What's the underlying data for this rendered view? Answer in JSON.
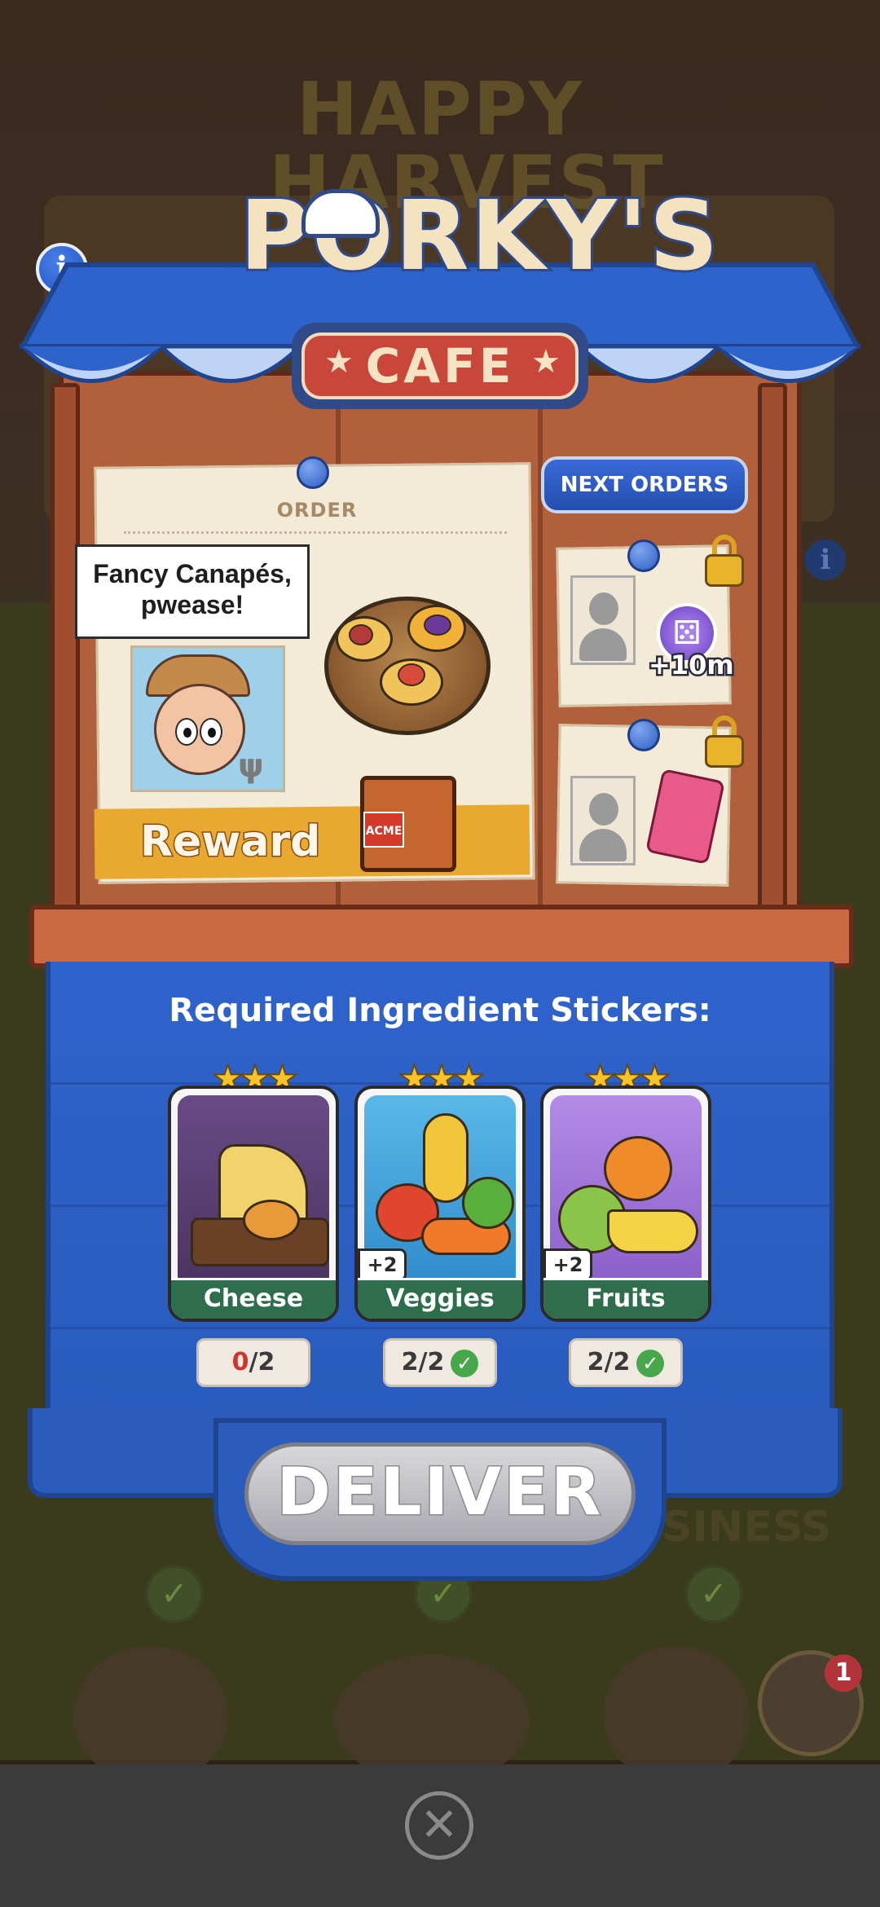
{
  "background": {
    "event_title_line1": "HAPPY",
    "event_title_line2": "HARVEST",
    "ghost_word_right": "SINESS"
  },
  "header": {
    "info_label": "i",
    "sign_title": "PORKY'S",
    "sign_subtitle": "CAFE"
  },
  "order": {
    "label": "ORDER",
    "speech": "Fancy Canapés, pwease!",
    "reward_label": "Reward",
    "reward_crate_text": "ACME"
  },
  "next_orders": {
    "button_label": "NEXT ORDERS",
    "items": [
      {
        "reward_text": "+10m",
        "locked": true,
        "reward_icon": "dice-token-icon"
      },
      {
        "locked": true,
        "reward_icon": "sticker-pack-icon"
      }
    ]
  },
  "ingredients": {
    "title": "Required Ingredient Stickers:",
    "items": [
      {
        "name": "Cheese",
        "stars": "★★★",
        "have": "0",
        "sep": "/",
        "need": "2",
        "tag": "",
        "complete": false
      },
      {
        "name": "Veggies",
        "stars": "★★★",
        "have": "2",
        "sep": "/",
        "need": "2",
        "tag": "+2",
        "complete": true
      },
      {
        "name": "Fruits",
        "stars": "★★★",
        "have": "2",
        "sep": "/",
        "need": "2",
        "tag": "+2",
        "complete": true
      }
    ]
  },
  "actions": {
    "deliver_label": "DELIVER",
    "close_label": "✕",
    "notification_count": "1"
  },
  "colors": {
    "panel_blue": "#2a5bbd",
    "awning_blue": "#2f63cc",
    "reward_orange": "#e9a92e",
    "card_green": "#2e6e4c",
    "deliver_gray": "#a9a9b0"
  }
}
